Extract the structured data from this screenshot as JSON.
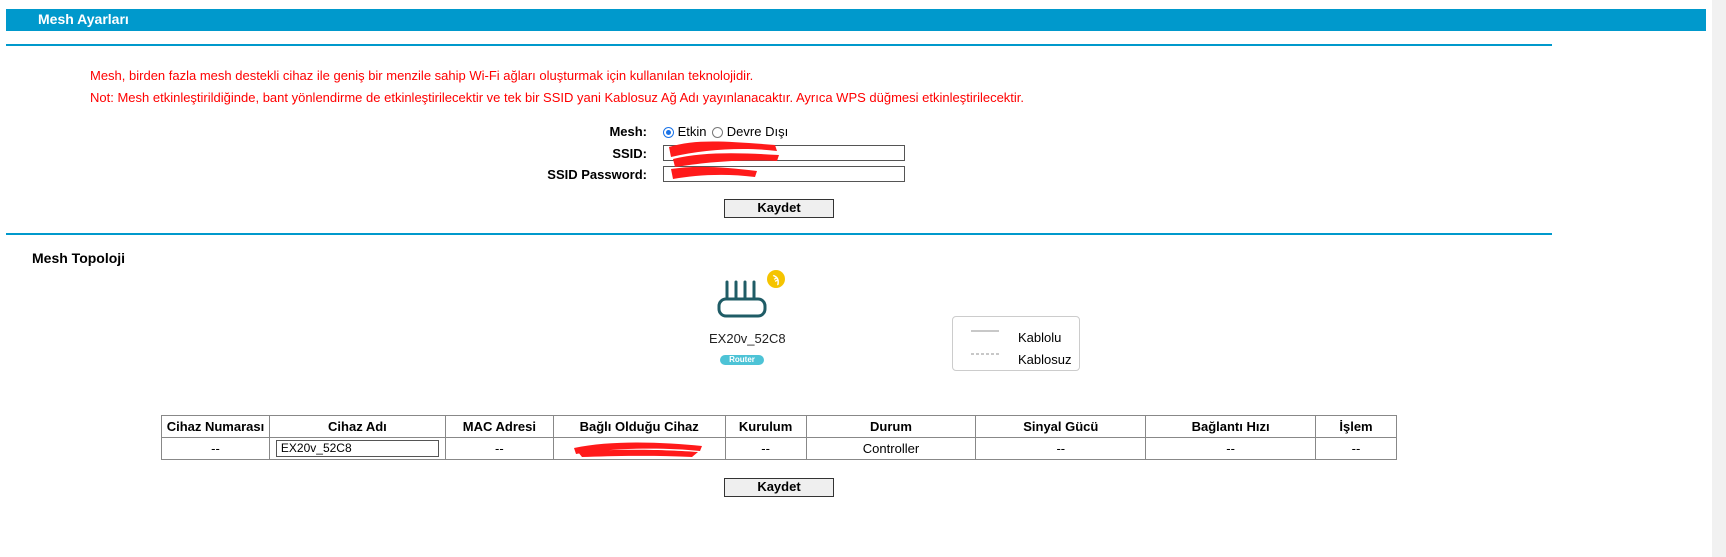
{
  "header": {
    "title": "Mesh Ayarları"
  },
  "notes": {
    "line1": "Mesh, birden fazla mesh destekli cihaz ile geniş bir menzile sahip Wi-Fi ağları oluşturmak için kullanılan teknolojidir.",
    "line2": "Not: Mesh etkinleştirildiğinde, bant yönlendirme de etkinleştirilecektir ve tek bir SSID yani Kablosuz Ağ Adı yayınlanacaktır. Ayrıca WPS düğmesi etkinleştirilecektir."
  },
  "form": {
    "mesh_label": "Mesh:",
    "mesh_options": [
      {
        "label": "Etkin",
        "selected": true
      },
      {
        "label": "Devre Dışı",
        "selected": false
      }
    ],
    "ssid_label": "SSID:",
    "ssid_value": "",
    "password_label": "SSID Password:",
    "password_value": "",
    "save_label": "Kaydet"
  },
  "topology": {
    "title": "Mesh Topoloji",
    "router_name": "EX20v_52C8",
    "router_badge": "Router",
    "legend": {
      "wired": "Kablolu",
      "wireless": "Kablosuz"
    }
  },
  "table": {
    "headers": [
      "Cihaz Numarası",
      "Cihaz Adı",
      "MAC Adresi",
      "Bağlı Olduğu Cihaz",
      "Kurulum",
      "Durum",
      "Sinyal Gücü",
      "Bağlantı Hızı",
      "İşlem"
    ],
    "rows": [
      {
        "number": "--",
        "name": "EX20v_52C8",
        "mac": "--",
        "connected_to": "",
        "setup": "--",
        "status": "Controller",
        "signal": "--",
        "speed": "--",
        "action": "--"
      }
    ],
    "save_label": "Kaydet"
  },
  "colors": {
    "accent": "#0099cc",
    "note": "#ff0000",
    "badge": "#4dc3d6",
    "router_icon": "#1f5c66",
    "warning": "#f5c400"
  }
}
